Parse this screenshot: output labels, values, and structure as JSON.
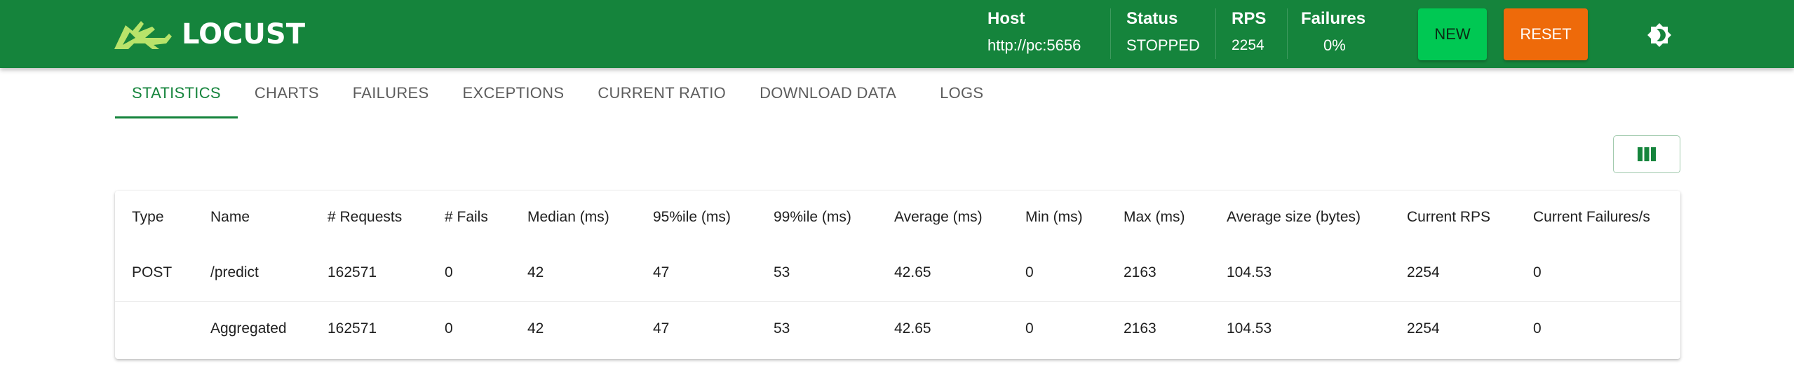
{
  "app": {
    "brand": "LOCUST",
    "colors": {
      "header": "#15843c",
      "new_button": "#00c853",
      "reset_button": "#ee6a0a",
      "accent": "#15843c"
    }
  },
  "header": {
    "host": {
      "label": "Host",
      "value": "http://pc:5656"
    },
    "status": {
      "label": "Status",
      "value": "STOPPED"
    },
    "rps": {
      "label": "RPS",
      "value": "2254"
    },
    "failures": {
      "label": "Failures",
      "value": "0%"
    },
    "new_label": "NEW",
    "reset_label": "RESET",
    "theme_icon": "brightness-icon"
  },
  "tabs": [
    {
      "label": "STATISTICS",
      "active": true
    },
    {
      "label": "CHARTS",
      "active": false
    },
    {
      "label": "FAILURES",
      "active": false
    },
    {
      "label": "EXCEPTIONS",
      "active": false
    },
    {
      "label": "CURRENT RATIO",
      "active": false
    },
    {
      "label": "DOWNLOAD DATA",
      "active": false
    },
    {
      "label": "LOGS",
      "active": false
    }
  ],
  "toolbar": {
    "columns_icon": "view-column-icon"
  },
  "table": {
    "columns": [
      "Type",
      "Name",
      "# Requests",
      "# Fails",
      "Median (ms)",
      "95%ile (ms)",
      "99%ile (ms)",
      "Average (ms)",
      "Min (ms)",
      "Max (ms)",
      "Average size (bytes)",
      "Current RPS",
      "Current Failures/s"
    ],
    "rows": [
      [
        "POST",
        "/predict",
        "162571",
        "0",
        "42",
        "47",
        "53",
        "42.65",
        "0",
        "2163",
        "104.53",
        "2254",
        "0"
      ]
    ],
    "aggregated": [
      "",
      "Aggregated",
      "162571",
      "0",
      "42",
      "47",
      "53",
      "42.65",
      "0",
      "2163",
      "104.53",
      "2254",
      "0"
    ]
  }
}
